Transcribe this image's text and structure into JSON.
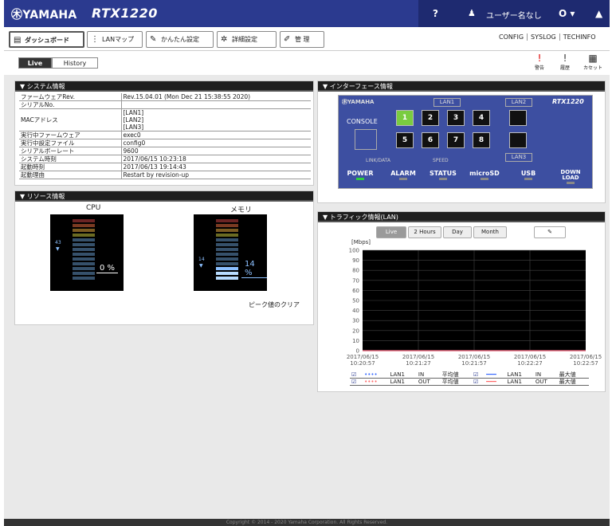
{
  "header": {
    "brand": "㊍YAMAHA",
    "model": "RTX1220",
    "help_icon": "?",
    "user_name": "ユーザー名なし",
    "power_glyph": "O ▾",
    "bell_glyph": "▲"
  },
  "nav": {
    "tabs": [
      {
        "label": "ダッシュボード",
        "icon": "▤"
      },
      {
        "label": "LANマップ",
        "icon": "⋮"
      },
      {
        "label": "かんたん設定",
        "icon": "✎"
      },
      {
        "label": "詳細設定",
        "icon": "✲"
      },
      {
        "label": "管 理",
        "icon": "✐"
      }
    ],
    "right_links": [
      "CONFIG",
      "SYSLOG",
      "TECHINFO"
    ]
  },
  "subbar": {
    "live_label": "Live",
    "history_label": "History",
    "warn_label": "警告",
    "history_icon_label": "履歴",
    "cassette_label": "カセット",
    "warn_glyph": "!",
    "hist_glyph": "!",
    "cassette_glyph": "▦"
  },
  "system": {
    "title": "▼  システム情報",
    "rows": [
      {
        "k": "ファームウェアRev.",
        "v": "Rev.15.04.01 (Mon Dec 21 15:38:55 2020)"
      },
      {
        "k": "シリアルNo.",
        "v": ""
      },
      {
        "k": "MACアドレス",
        "v": "[LAN1]\n[LAN2]\n[LAN3]"
      },
      {
        "k": "実行中ファームウェア",
        "v": "exec0"
      },
      {
        "k": "実行中設定ファイル",
        "v": "config0"
      },
      {
        "k": "シリアルボーレート",
        "v": "9600"
      },
      {
        "k": "システム時刻",
        "v": "2017/06/15 10:23:18"
      },
      {
        "k": "起動時刻",
        "v": "2017/06/13 19:14:43"
      },
      {
        "k": "起動理由",
        "v": "Restart by revision-up"
      }
    ]
  },
  "resource": {
    "title": "▼  リソース情報",
    "cpu_label": "CPU",
    "mem_label": "メモリ",
    "cpu_peak": "43",
    "cpu_value": "0 %",
    "mem_peak": "14",
    "mem_value": "14 %",
    "clear_peak": "ピーク値のクリア"
  },
  "interface": {
    "title": "▼  インターフェース情報",
    "brand": "㊍YAMAHA",
    "model": "RTX1220",
    "console_label": "CONSOLE",
    "lan1": "LAN1",
    "lan2": "LAN2",
    "lan3": "LAN3",
    "ports": [
      "1",
      "2",
      "3",
      "4",
      "5",
      "6",
      "7",
      "8"
    ],
    "link_label": "LINK/DATA",
    "speed_label": "SPEED",
    "leds": [
      "POWER",
      "ALARM",
      "STATUS",
      "microSD",
      "USB",
      "DOWN LOAD"
    ]
  },
  "traffic": {
    "title": "▼  トラフィック情報(LAN)",
    "tabs": [
      "Live",
      "2 Hours",
      "Day",
      "Month"
    ],
    "edit_icon": "✎",
    "legend": [
      {
        "check": "☑",
        "line": "••••",
        "port": "LAN1",
        "dir": "IN",
        "kind": "平均値",
        "check2": "☑",
        "line2": "━━━",
        "port2": "LAN1",
        "dir2": "IN",
        "kind2": "最大値"
      },
      {
        "check": "☑",
        "line": "••••",
        "port": "LAN1",
        "dir": "OUT",
        "kind": "平均値",
        "check2": "☑",
        "line2": "━━━",
        "port2": "LAN1",
        "dir2": "OUT",
        "kind2": "最大値"
      }
    ]
  },
  "chart_data": {
    "type": "line",
    "ylabel": "[Mbps]",
    "ylim": [
      0,
      100
    ],
    "yticks": [
      "100",
      "90",
      "80",
      "70",
      "60",
      "50",
      "40",
      "30",
      "20",
      "10",
      "0"
    ],
    "x": [
      [
        "2017/06/15",
        "10:20:57"
      ],
      [
        "2017/06/15",
        "10:21:27"
      ],
      [
        "2017/06/15",
        "10:21:57"
      ],
      [
        "2017/06/15",
        "10:22:27"
      ],
      [
        "2017/06/15",
        "10:22:57"
      ]
    ],
    "series": [
      {
        "name": "LAN1 IN 平均値",
        "values": [
          0,
          0,
          0,
          0,
          0
        ]
      },
      {
        "name": "LAN1 OUT 平均値",
        "values": [
          0,
          0,
          0,
          0,
          0
        ]
      }
    ],
    "grid": true
  },
  "footer": "Copyright © 2014 - 2020 Yamaha Corporation. All Rights Reserved.",
  "colors": {
    "accent": "#2b3a8f",
    "link_on": "#7acc40",
    "led_on": "#2ecc40",
    "out_line": "#ff6666"
  }
}
